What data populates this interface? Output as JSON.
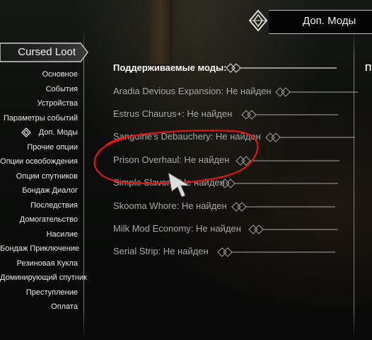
{
  "header": {
    "title": "Доп. Моды"
  },
  "menu": {
    "cursed_loot_label": "Cursed Loot",
    "items": [
      {
        "label": "Основное"
      },
      {
        "label": "События"
      },
      {
        "label": "Устройства"
      },
      {
        "label": "Параметры событий"
      },
      {
        "label": "Доп. Моды",
        "selected": true
      },
      {
        "label": "Прочие опции"
      },
      {
        "label": "Опции освобождения"
      },
      {
        "label": "Опции спутников"
      },
      {
        "label": "Бондаж Диалог"
      },
      {
        "label": "Последствия"
      },
      {
        "label": "Домогательство"
      },
      {
        "label": "Насилие"
      },
      {
        "label": "Бондаж Приключение"
      },
      {
        "label": "Резиновая Кукла"
      },
      {
        "label": "Доминирующий спутник"
      },
      {
        "label": "Преступление"
      },
      {
        "label": "Оплата"
      }
    ]
  },
  "mods": {
    "header": "Поддерживаемые моды:",
    "rows": [
      {
        "text": "Aradia Devious Expansion: Не найден"
      },
      {
        "text": "Estrus Chaurus+: Не найден"
      },
      {
        "text": "Sanguine's Debauchery: Не найден"
      },
      {
        "text": "Prison Overhaul: Не найден",
        "circled": true
      },
      {
        "text": "Simple Slavery: Не найден"
      },
      {
        "text": "Skooma Whore: Не найден"
      },
      {
        "text": "Milk Mod Economy: Не найден"
      },
      {
        "text": "Serial Strip: Не найден"
      }
    ]
  },
  "right_column": {
    "label": "П"
  },
  "colors": {
    "annotation": "#e01515",
    "text_dim": "#a8a8a8",
    "text_bright": "#f5f5f5"
  }
}
